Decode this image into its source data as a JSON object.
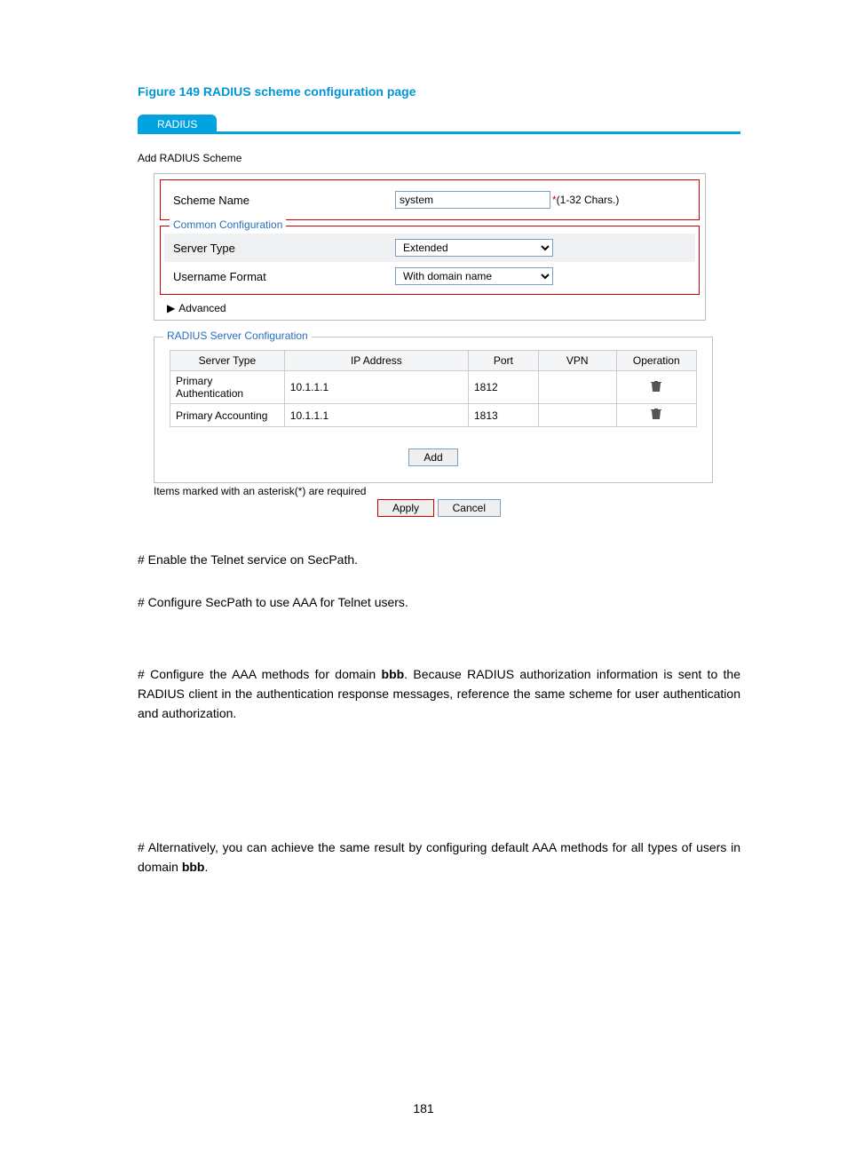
{
  "figure_title": "Figure 149 RADIUS scheme configuration page",
  "tab": {
    "label": "RADIUS"
  },
  "heading_add_scheme": "Add RADIUS Scheme",
  "scheme": {
    "name_label": "Scheme Name",
    "name_value": "system",
    "asterisk": "*",
    "hint": "(1-32 Chars.)"
  },
  "common": {
    "legend": "Common Configuration",
    "server_type_label": "Server Type",
    "server_type_value": "Extended",
    "username_format_label": "Username Format",
    "username_format_value": "With domain name"
  },
  "advanced_label": "Advanced",
  "server_section": {
    "legend": "RADIUS Server Configuration",
    "columns": {
      "server_type": "Server Type",
      "ip": "IP Address",
      "port": "Port",
      "vpn": "VPN",
      "operation": "Operation"
    },
    "rows": [
      {
        "type": "Primary Authentication",
        "ip": "10.1.1.1",
        "port": "1812",
        "vpn": ""
      },
      {
        "type": "Primary Accounting",
        "ip": "10.1.1.1",
        "port": "1813",
        "vpn": ""
      }
    ],
    "add_button": "Add"
  },
  "required_note": "Items marked with an asterisk(*) are required",
  "buttons": {
    "apply": "Apply",
    "cancel": "Cancel"
  },
  "copy": {
    "p1": "# Enable the Telnet service on SecPath.",
    "p2": "# Configure SecPath to use AAA for Telnet users.",
    "p3a": "# Configure the AAA methods for domain ",
    "p3b": "bbb",
    "p3c": ". Because RADIUS authorization information is sent to the RADIUS client in the authentication response messages, reference the same scheme for user authentication and authorization.",
    "p4a": "# Alternatively, you can achieve the same result by configuring default AAA methods for all types of users in domain ",
    "p4b": "bbb",
    "p4c": "."
  },
  "page_number": "181"
}
